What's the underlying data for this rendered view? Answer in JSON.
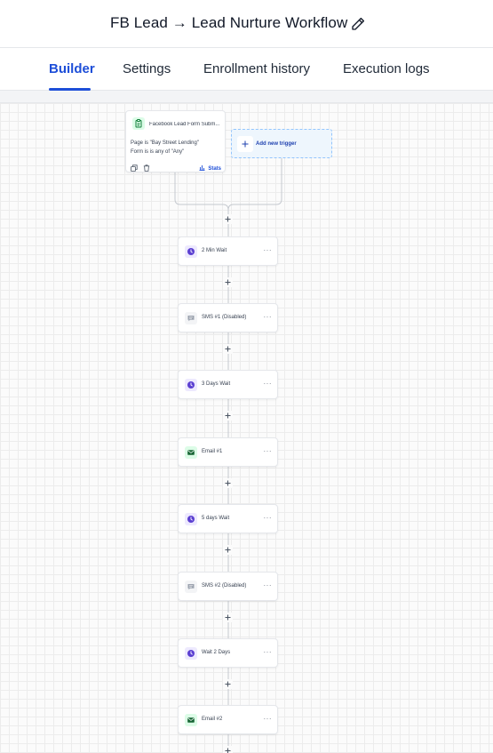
{
  "header": {
    "title": "FB Lead → Lead Nurture Workflow",
    "edit_icon": "pencil-icon"
  },
  "tabs": [
    {
      "label": "Builder",
      "active": true
    },
    {
      "label": "Settings",
      "active": false
    },
    {
      "label": "Enrollment history",
      "active": false
    },
    {
      "label": "Execution logs",
      "active": false
    }
  ],
  "trigger": {
    "title": "Facebook Lead Form Subm...",
    "conditions": [
      "Page is \"Bay Street Lending\"",
      "Form is is any of \"Any\""
    ],
    "stats_label": "Stats",
    "icon": "clipboard-icon"
  },
  "add_trigger": {
    "label": "Add new trigger"
  },
  "steps": [
    {
      "label": "2 Min Wait",
      "type": "wait"
    },
    {
      "label": "SMS #1 (Disabled)",
      "type": "sms"
    },
    {
      "label": "3 Days Wait",
      "type": "wait"
    },
    {
      "label": "Email #1",
      "type": "email"
    },
    {
      "label": "5 days Wait",
      "type": "wait"
    },
    {
      "label": "SMS #2 (Disabled)",
      "type": "sms"
    },
    {
      "label": "Wait 2 Days",
      "type": "wait"
    },
    {
      "label": "Email #2",
      "type": "email"
    }
  ],
  "colors": {
    "accent": "#1d4ed8",
    "wait": "#5b3fd1",
    "email": "#166534",
    "sms": "#9ca3af"
  }
}
